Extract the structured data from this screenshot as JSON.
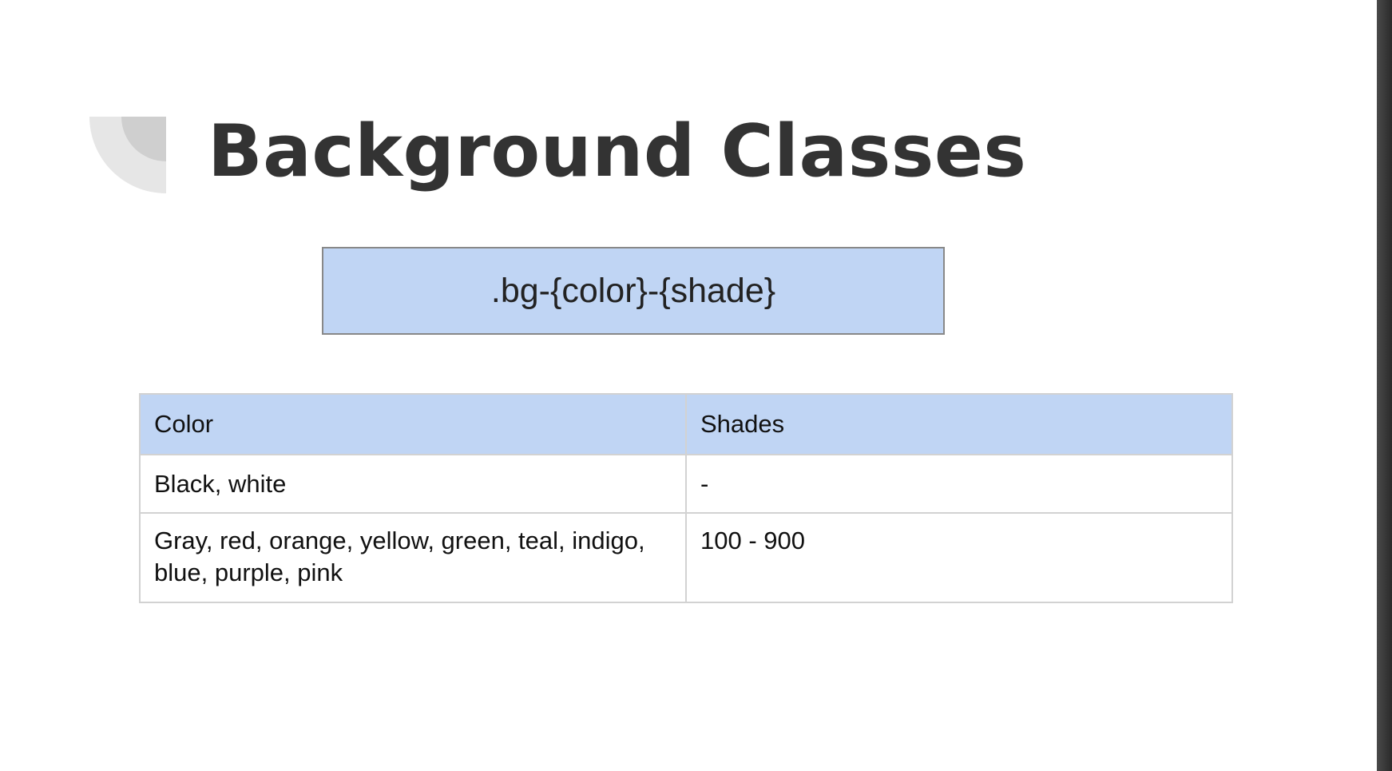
{
  "slide": {
    "title": "Background Classes",
    "title_icon": "quarter-circle-mark-icon",
    "formula": ".bg-{color}-{shade}"
  },
  "table": {
    "headers": [
      "Color",
      "Shades"
    ],
    "rows": [
      [
        "Black, white",
        "-"
      ],
      [
        "Gray, red, orange, yellow, green, teal, indigo, blue, purple, pink",
        "100 - 900"
      ]
    ]
  },
  "colors": {
    "accent_fill": "#c0d5f4",
    "title_text": "#333333",
    "table_border": "#d2d2d2"
  }
}
